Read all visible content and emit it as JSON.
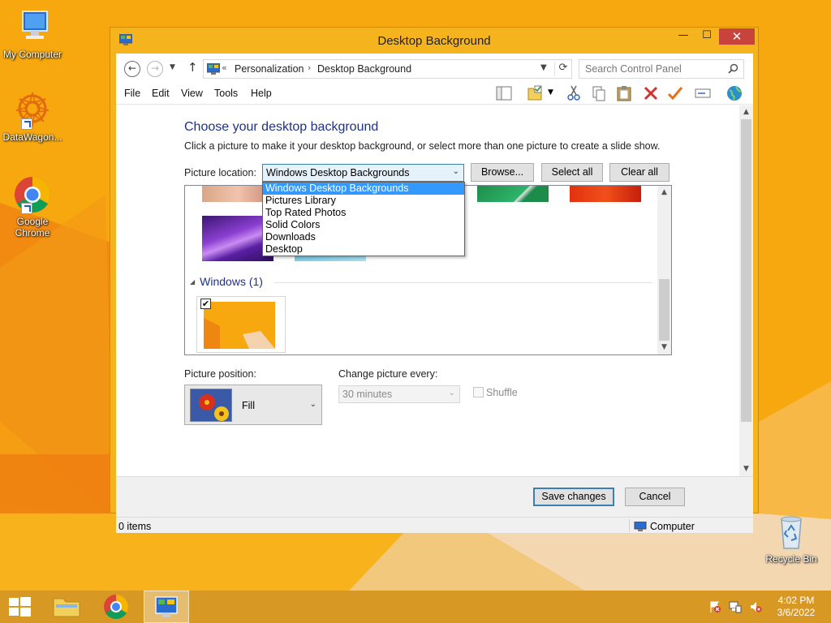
{
  "desktop": {
    "icons": [
      {
        "label": "My Computer"
      },
      {
        "label": "DataWagon..."
      },
      {
        "label": "Google Chrome"
      },
      {
        "label": "Recycle Bin"
      }
    ]
  },
  "window": {
    "title": "Desktop Background",
    "close_glyph": "✕",
    "minimize_glyph": "—",
    "maximize_glyph": "☐"
  },
  "addressbar": {
    "prefix": "«",
    "crumbs": [
      "Personalization",
      "Desktop Background"
    ],
    "separator": "›",
    "search_placeholder": "Search Control Panel"
  },
  "menubar": {
    "items": [
      "File",
      "Edit",
      "View",
      "Tools",
      "Help"
    ]
  },
  "page": {
    "heading": "Choose your desktop background",
    "subtext": "Click a picture to make it your desktop background, or select more than one picture to create a slide show.",
    "picture_location_label": "Picture location:",
    "picture_location_value": "Windows Desktop Backgrounds",
    "browse_label": "Browse...",
    "select_all_label": "Select all",
    "clear_all_label": "Clear all",
    "location_options": [
      "Windows Desktop Backgrounds",
      "Pictures Library",
      "Top Rated Photos",
      "Solid Colors",
      "Downloads",
      "Desktop"
    ],
    "group_header": "Windows (1)",
    "picture_position_label": "Picture position:",
    "picture_position_value": "Fill",
    "change_every_label": "Change picture every:",
    "change_every_value": "30 minutes",
    "shuffle_label": "Shuffle",
    "save_label": "Save changes",
    "cancel_label": "Cancel"
  },
  "statusbar": {
    "items_text": "0 items",
    "location_text": "Computer"
  },
  "taskbar": {
    "time": "4:02 PM",
    "date": "3/6/2022"
  },
  "colors": {
    "wallpaper_orange": "#f7a80e",
    "heading_blue": "#1e3287",
    "selection_blue": "#3399ff",
    "close_red": "#c7433c"
  }
}
